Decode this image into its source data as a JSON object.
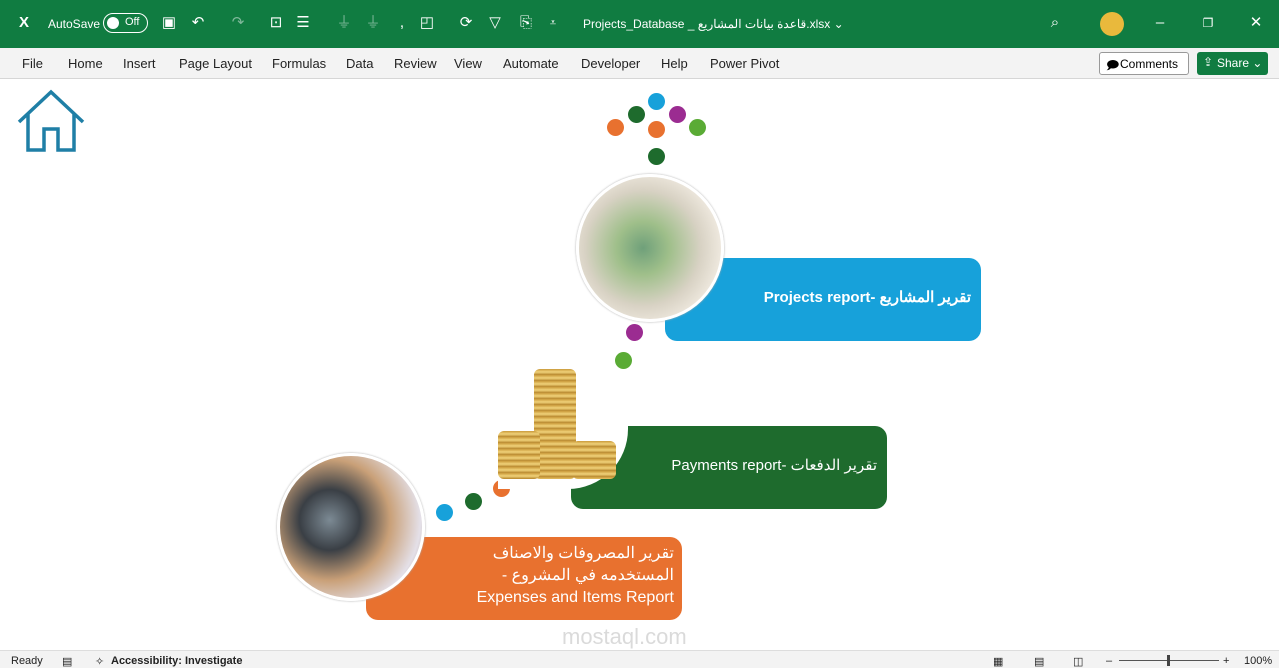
{
  "titlebar": {
    "autosave_label": "AutoSave",
    "autosave_state": "Off",
    "file_name": "Projects_Database _ قاعدة بيانات المشاريع.xlsx"
  },
  "ribbon": {
    "tabs": [
      "File",
      "Home",
      "Insert",
      "Page Layout",
      "Formulas",
      "Data",
      "Review",
      "View",
      "Automate",
      "Developer",
      "Help",
      "Power Pivot"
    ],
    "comments_label": "Comments",
    "share_label": "Share"
  },
  "sheet": {
    "projects_label": "تقرير المشاريع -Projects report",
    "payments_label": "تقرير الدفعات -Payments report",
    "expenses_label_ar_line1": "تقرير المصروفات والاصناف",
    "expenses_label_ar_line2": "المستخدمه في المشروع -",
    "expenses_label_en": "Expenses and Items Report",
    "watermark": "mostaql.com",
    "colors": {
      "blue": "#17a1da",
      "green": "#1e6b2d",
      "orange": "#e8712f",
      "purple": "#9b2c91",
      "light_green": "#5aab35"
    }
  },
  "status": {
    "ready": "Ready",
    "accessibility": "Accessibility: Investigate",
    "zoom": "100%"
  }
}
